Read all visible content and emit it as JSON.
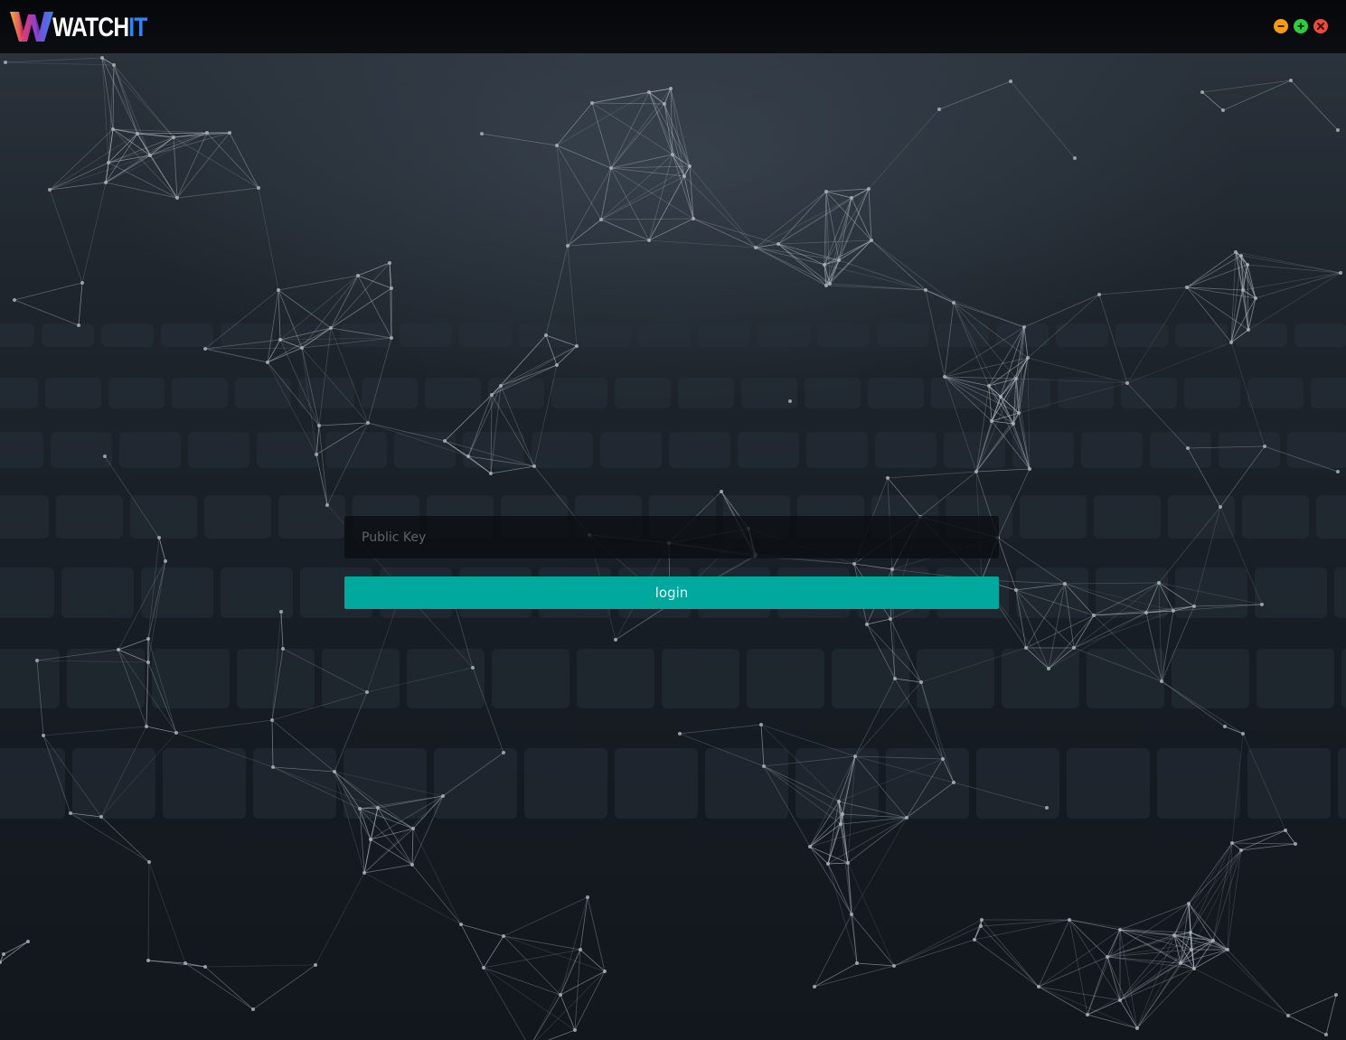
{
  "app": {
    "logo_part1": "WATCH",
    "logo_part2": "IT",
    "logo_letter": "W"
  },
  "window_controls": {
    "minimize_color": "#f39c12",
    "maximize_color": "#2ecc40",
    "close_color": "#e74c3c"
  },
  "login": {
    "public_key_placeholder": "Public Key",
    "public_key_value": "",
    "login_label": "login",
    "accent_color": "#00a89d"
  }
}
